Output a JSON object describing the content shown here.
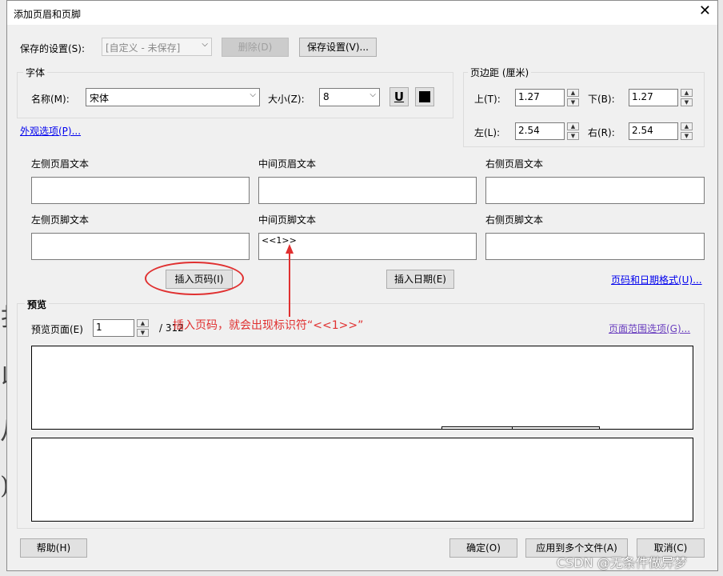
{
  "window": {
    "title": "添加页眉和页脚",
    "close_glyph": "✕"
  },
  "saved_settings": {
    "label": "保存的设置(S):",
    "value": "[自定义 - 未保存]",
    "delete_button": "删除(D)",
    "save_button": "保存设置(V)..."
  },
  "font": {
    "section": "字体",
    "name_label": "名称(M):",
    "name_value": "宋体",
    "size_label": "大小(Z):",
    "size_value": "8",
    "underline_glyph": "U"
  },
  "margins": {
    "section": "页边距 (厘米)",
    "top_label": "上(T):",
    "top_value": "1.27",
    "bottom_label": "下(B):",
    "bottom_value": "1.27",
    "left_label": "左(L):",
    "left_value": "2.54",
    "right_label": "右(R):",
    "right_value": "2.54"
  },
  "appearance_link": "外观选项(P)...",
  "header": {
    "left_label": "左侧页眉文本",
    "center_label": "中间页眉文本",
    "right_label": "右侧页眉文本",
    "left_value": "",
    "center_value": "",
    "right_value": ""
  },
  "footer": {
    "left_label": "左侧页脚文本",
    "center_label": "中间页脚文本",
    "right_label": "右侧页脚文本",
    "left_value": "",
    "center_value": "<<1>>",
    "right_value": ""
  },
  "insert_page_button": "插入页码(I)",
  "insert_date_button": "插入日期(E)",
  "page_date_format_link": "页码和日期格式(U)...",
  "preview": {
    "section": "预览",
    "page_label": "预览页面(E)",
    "page_value": "1",
    "page_total": "/ 312",
    "range_link": "页面范围选项(G)..."
  },
  "annotation": "插入页码，就会出现标识符“<<1>>”",
  "buttons": {
    "help": "帮助(H)",
    "ok": "确定(O)",
    "apply_multi": "应用到多个文件(A)",
    "cancel": "取消(C)"
  },
  "watermark": "CSDN @无条件做异梦",
  "colors": {
    "annotation": "#e03030",
    "link": "#0000ee",
    "dialog_bg": "#f0f0f0"
  }
}
